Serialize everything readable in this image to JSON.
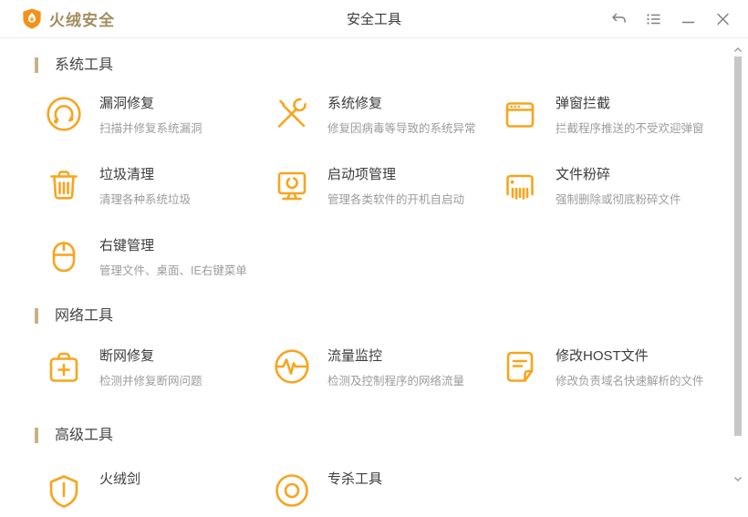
{
  "window": {
    "app_name": "火绒安全",
    "title": "安全工具",
    "controls": [
      {
        "icon": "back-arrow-icon",
        "action": "back"
      },
      {
        "icon": "menu-list-icon",
        "action": "menu"
      },
      {
        "icon": "minimize-icon",
        "action": "minimize"
      },
      {
        "icon": "close-icon",
        "action": "close"
      }
    ]
  },
  "colors": {
    "accent_orange": "#F8A41D",
    "logo_text": "#A18D5F",
    "section_bar": "#C8B188",
    "title_text": "#3C3C3C",
    "desc_text": "#9C9C9C",
    "scrollbar_thumb": "#C7C7C7"
  },
  "sections": [
    {
      "title": "系统工具",
      "tools": [
        {
          "icon": "vulnerability-patch-icon",
          "name": "漏洞修复",
          "desc": "扫描并修复系统漏洞"
        },
        {
          "icon": "repair-tools-icon",
          "name": "系统修复",
          "desc": "修复因病毒等导致的系统异常"
        },
        {
          "icon": "popup-window-icon",
          "name": "弹窗拦截",
          "desc": "拦截程序推送的不受欢迎弹窗"
        },
        {
          "icon": "trash-icon",
          "name": "垃圾清理",
          "desc": "清理各种系统垃圾"
        },
        {
          "icon": "monitor-startup-icon",
          "name": "启动项管理",
          "desc": "管理各类软件的开机自启动"
        },
        {
          "icon": "shredder-icon",
          "name": "文件粉碎",
          "desc": "强制删除或彻底粉碎文件"
        },
        {
          "icon": "mouse-icon",
          "name": "右键管理",
          "desc": "管理文件、桌面、IE右键菜单"
        }
      ]
    },
    {
      "title": "网络工具",
      "tools": [
        {
          "icon": "first-aid-kit-icon",
          "name": "断网修复",
          "desc": "检测并修复断网问题"
        },
        {
          "icon": "pulse-monitor-icon",
          "name": "流量监控",
          "desc": "检测及控制程序的网络流量"
        },
        {
          "icon": "host-file-icon",
          "name": "修改HOST文件",
          "desc": "修改负责域名快速解析的文件"
        }
      ]
    },
    {
      "title": "高级工具",
      "tools": [
        {
          "icon": "shield-sword-icon",
          "name": "火绒剑"
        },
        {
          "icon": "target-circle-icon",
          "name": "专杀工具"
        }
      ]
    }
  ]
}
